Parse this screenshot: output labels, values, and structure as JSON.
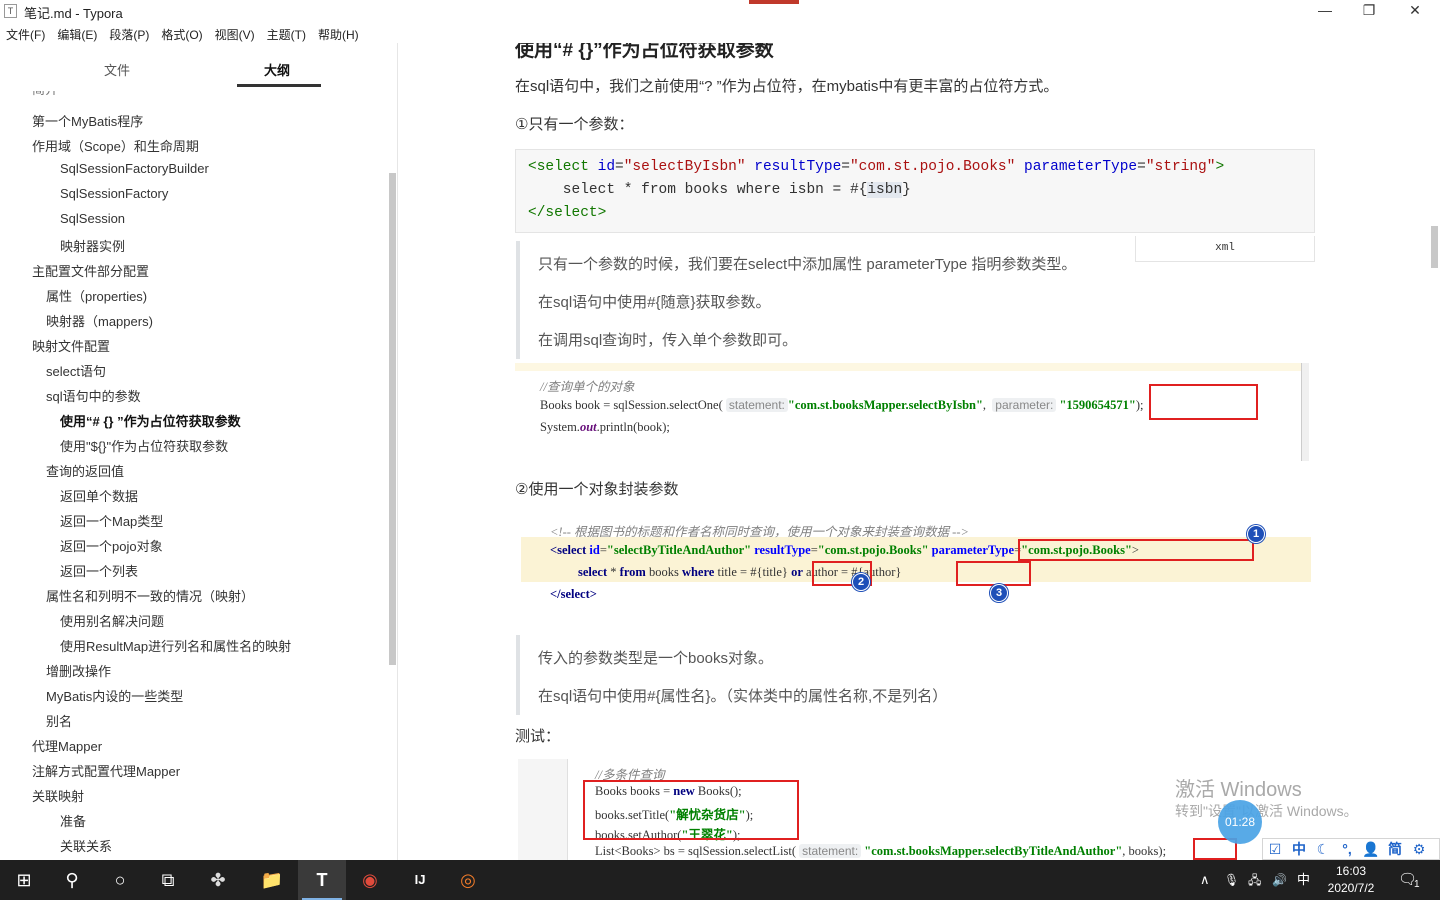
{
  "window": {
    "title": "笔记.md - Typora",
    "app_icon": "T",
    "minimize": "—",
    "maximize": "❐",
    "close": "✕"
  },
  "menu": [
    "文件(F)",
    "编辑(E)",
    "段落(P)",
    "格式(O)",
    "视图(V)",
    "主题(T)",
    "帮助(H)"
  ],
  "sidebar": {
    "tab_files": "文件",
    "tab_outline": "大纲",
    "cut_item": "简介",
    "items": [
      {
        "label": "第一个MyBatis程序",
        "level": 1
      },
      {
        "label": "作用域（Scope）和生命周期",
        "level": 1
      },
      {
        "label": "SqlSessionFactoryBuilder",
        "level": 3
      },
      {
        "label": "SqlSessionFactory",
        "level": 3
      },
      {
        "label": "SqlSession",
        "level": 3
      },
      {
        "label": "映射器实例",
        "level": 3
      },
      {
        "label": "主配置文件部分配置",
        "level": 1
      },
      {
        "label": "属性（properties)",
        "level": 2
      },
      {
        "label": "映射器（mappers)",
        "level": 2
      },
      {
        "label": "映射文件配置",
        "level": 1
      },
      {
        "label": "select语句",
        "level": 2
      },
      {
        "label": "sql语句中的参数",
        "level": 2
      },
      {
        "label": "使用“# {} ”作为占位符获取参数",
        "level": 3,
        "active": true
      },
      {
        "label": "使用\"${}\"作为占位符获取参数",
        "level": 3
      },
      {
        "label": "查询的返回值",
        "level": 2
      },
      {
        "label": "返回单个数据",
        "level": 3
      },
      {
        "label": "返回一个Map类型",
        "level": 3
      },
      {
        "label": "返回一个pojo对象",
        "level": 3
      },
      {
        "label": "返回一个列表",
        "level": 3
      },
      {
        "label": "属性名和列明不一致的情况（映射）",
        "level": 2
      },
      {
        "label": "使用别名解决问题",
        "level": 3
      },
      {
        "label": "使用ResultMap进行列名和属性名的映射",
        "level": 3
      },
      {
        "label": "增删改操作",
        "level": 2
      },
      {
        "label": "MyBatis内设的一些类型",
        "level": 2
      },
      {
        "label": "别名",
        "level": 2
      },
      {
        "label": "代理Mapper",
        "level": 1
      },
      {
        "label": "注解方式配置代理Mapper",
        "level": 1
      },
      {
        "label": "关联映射",
        "level": 1
      },
      {
        "label": "准备",
        "level": 3
      },
      {
        "label": "关联关系",
        "level": 3
      }
    ],
    "footer_back": "<",
    "footer_source": "</>"
  },
  "doc": {
    "heading_cut": "使用“# {}”作为占位符获取参数",
    "intro": "在sql语句中，我们之前使用“? ”作为占位符，在mybatis中有更丰富的占位符方式。",
    "case1_title": "①只有一个参数：",
    "code1": {
      "l1_tag_open": "<select ",
      "l1_attr1": "id",
      "l1_val1": "\"selectByIsbn\"",
      "l1_attr2": " resultType",
      "l1_val2": "\"com.st.pojo.Books\"",
      "l1_attr3": " parameterType",
      "l1_val3": "\"string\"",
      "l1_close": ">",
      "l2_pre": "    select * from books where isbn = #{",
      "l2_hl": "isbn",
      "l2_post": "}",
      "l3": "</select>",
      "lang": "xml"
    },
    "quote1": [
      "只有一个参数的时候，我们要在select中添加属性 parameterType 指明参数类型。",
      "在sql语句中使用#{随意}获取参数。",
      "在调用sql查询时，传入单个参数即可。"
    ],
    "shot1": {
      "comment": "//查询单个的对象",
      "line2_pre": "Books book = sqlSession.selectOne(",
      "hint1": "statement:",
      "str1": "\"com.st.booksMapper.selectByIsbn\"",
      "comma": ",",
      "hint2": "parameter:",
      "str2": "\"1590654571\"",
      "line2_post": ");",
      "line3_pre": "System.",
      "line3_field": "out",
      "line3_post": ".println(book);"
    },
    "case2_title": "②使用一个对象封装参数",
    "shot2": {
      "comment": "<!-- 根据图书的标题和作者名称同时查询，使用一个对象来封装查询数据 -->",
      "l2_tag": "<select ",
      "l2_attr1": "id",
      "l2_val1": "\"selectByTitleAndAuthor\"",
      "l2_attr2": " resultType",
      "l2_val2": "\"com.st.pojo.Books\"",
      "l2_attr3": "parameterType",
      "l2_val3": "\"com.st.pojo.Books\"",
      "l2_close": ">",
      "l3_kw1": "select",
      "l3_a": " * ",
      "l3_kw2": "from",
      "l3_b": " books ",
      "l3_kw3": "where",
      "l3_c": " title = ",
      "l3_p1": "#{titl",
      "l3_p1b": "e}",
      "l3_kw4": "or",
      "l3_d": " author = ",
      "l3_p2": "#{author}",
      "l4": "</select>",
      "badge1": "1",
      "badge2": "2",
      "badge3": "3"
    },
    "quote2": [
      "传入的参数类型是一个books对象。",
      "在sql语句中使用#{属性名}。（实体类中的属性名称,不是列名）"
    ],
    "test_title": "测试：",
    "shot3": {
      "comment": "//多条件查询",
      "l2_pre": "Books books = ",
      "l2_kw": "new",
      "l2_post": " Books();",
      "l3_pre": "books.setTitle(",
      "l3_str": "\"解忧杂货店\"",
      "l3_post": ");",
      "l4_pre": "books.setAuthor(",
      "l4_str": "\"王翠花\"",
      "l4_post": ");",
      "l5_pre": "List<Books> bs = sqlSession.selectList(",
      "l5_hint": "statement:",
      "l5_str": "\"com.st.booksMapper.selectByTitleAndAuthor\"",
      "l5_comma": ",",
      "l5_arg": "books",
      "l5_post": ");"
    }
  },
  "overlay": {
    "activate_title": "激活 Windows",
    "activate_sub": "转到\"设置\"以激活 Windows。",
    "timer": "01:28",
    "ime": [
      "☑",
      "中",
      "☾",
      "°,",
      "👤",
      "简",
      "⚙"
    ]
  },
  "taskbar": {
    "start": "⊞",
    "search": "⚲",
    "cortana": "○",
    "taskview": "⧉",
    "apps": [
      "✤",
      "📁",
      "T",
      "◉",
      "IJ",
      "◎"
    ],
    "tray_up": "∧",
    "tray_mic": "🎙",
    "tray_net": "🖧",
    "tray_vol": "🔊",
    "tray_lang": "中",
    "time": "16:03",
    "date": "2020/7/2",
    "notif": "🗨",
    "notif_count": "1"
  }
}
